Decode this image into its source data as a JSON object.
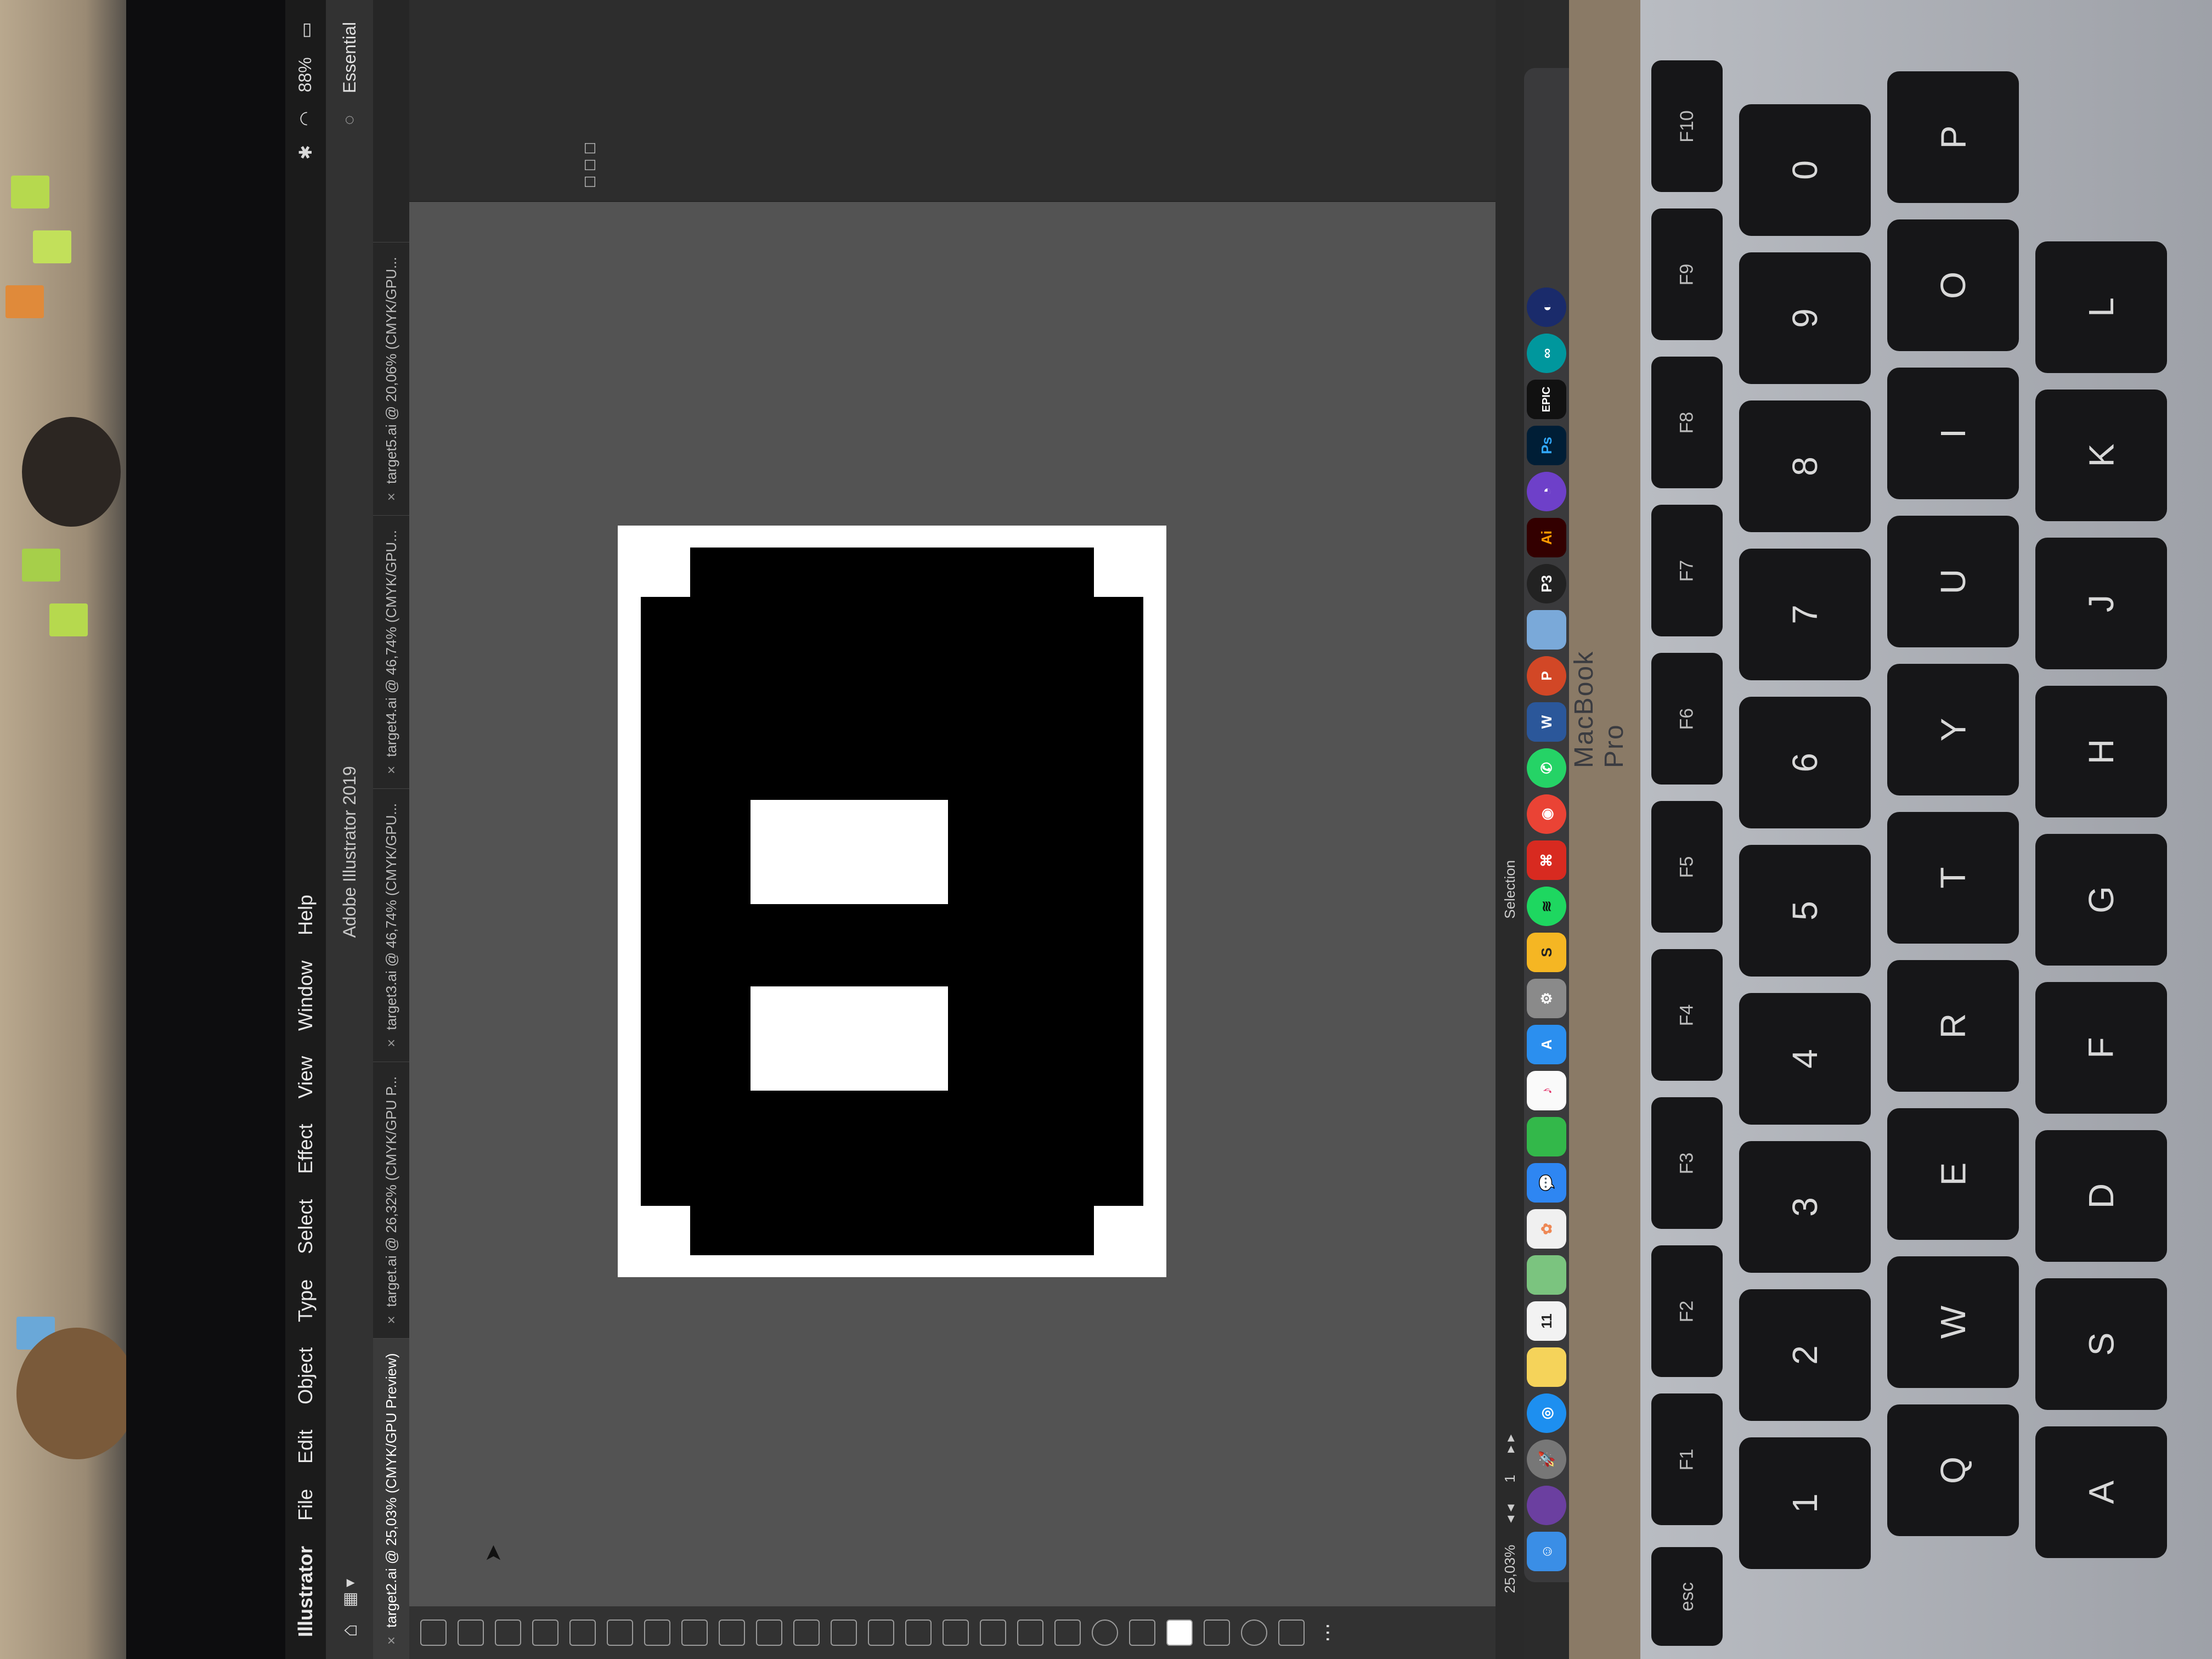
{
  "menubar": {
    "app": "Illustrator",
    "items": [
      "File",
      "Edit",
      "Object",
      "Type",
      "Select",
      "Effect",
      "View",
      "Window",
      "Help"
    ],
    "battery": "88%"
  },
  "appbar": {
    "title": "Adobe Illustrator 2019",
    "workspace": "Essential"
  },
  "tabs": [
    {
      "label": "target2.ai @ 25,03% (CMYK/GPU Preview)"
    },
    {
      "label": "target.ai @ 26,32% (CMYK/GPU P..."
    },
    {
      "label": "target3.ai @ 46,74% (CMYK/GPU..."
    },
    {
      "label": "target4.ai @ 46,74% (CMYK/GPU..."
    },
    {
      "label": "target5.ai @ 20,06% (CMYK/GPU..."
    }
  ],
  "statusbar": {
    "zoom": "25,03%",
    "artboard": "1",
    "tool": "Selection"
  },
  "dock": {
    "icons": [
      "finder-icon",
      "siri-icon",
      "launchpad-icon",
      "safari-icon",
      "notes-icon",
      "calendar-icon",
      "maps-icon",
      "photos-icon",
      "messages-icon",
      "facetime-icon",
      "itunes-icon",
      "app-store-icon",
      "system-preferences-icon",
      "sketch-icon",
      "spotify-icon",
      "acrobat-icon",
      "chrome-icon",
      "whatsapp-icon",
      "word-icon",
      "powerpoint-icon",
      "preview-icon",
      "p3-icon",
      "illustrator-icon",
      "github-desktop-icon",
      "photoshop-icon",
      "epic-games-icon",
      "arduino-icon",
      "cinema4d-icon"
    ],
    "illustrator_label": "Ai",
    "photoshop_label": "Ps",
    "epic_label": "EPIC"
  },
  "device": {
    "label": "MacBook Pro"
  },
  "keyboard": {
    "row_num": [
      "1",
      "2",
      "3",
      "4",
      "5",
      "6",
      "7",
      "8",
      "9",
      "0"
    ],
    "row_num_shift": [
      "!",
      "@",
      "#",
      "$",
      "%",
      "^",
      "&",
      "*",
      "(",
      ")"
    ],
    "row_q": [
      "Q",
      "W",
      "E",
      "R",
      "T",
      "Y",
      "U",
      "I",
      "O",
      "P"
    ],
    "row_a": [
      "A",
      "S",
      "D",
      "F",
      "G",
      "H",
      "J",
      "K",
      "L"
    ],
    "fkeys": [
      "F1",
      "F2",
      "F3",
      "F4",
      "F5",
      "F6",
      "F7",
      "F8",
      "F9",
      "F10"
    ],
    "esc": "esc"
  },
  "colors": {
    "artboard": "#ffffff",
    "marker": "#000000",
    "canvas": "#535353"
  }
}
